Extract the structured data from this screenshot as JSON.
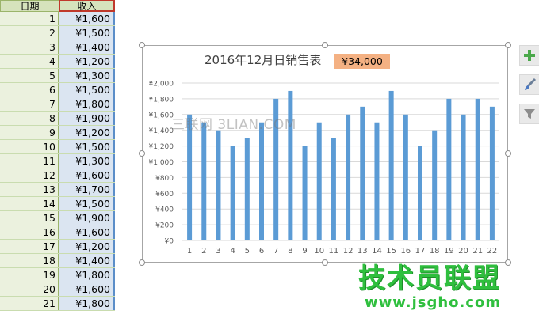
{
  "sheet": {
    "headers": {
      "date": "日期",
      "income": "收入"
    },
    "rows": [
      {
        "day": "1",
        "income": "¥1,600"
      },
      {
        "day": "2",
        "income": "¥1,500"
      },
      {
        "day": "3",
        "income": "¥1,400"
      },
      {
        "day": "4",
        "income": "¥1,200"
      },
      {
        "day": "5",
        "income": "¥1,300"
      },
      {
        "day": "6",
        "income": "¥1,500"
      },
      {
        "day": "7",
        "income": "¥1,800"
      },
      {
        "day": "8",
        "income": "¥1,900"
      },
      {
        "day": "9",
        "income": "¥1,200"
      },
      {
        "day": "10",
        "income": "¥1,500"
      },
      {
        "day": "11",
        "income": "¥1,300"
      },
      {
        "day": "12",
        "income": "¥1,600"
      },
      {
        "day": "13",
        "income": "¥1,700"
      },
      {
        "day": "14",
        "income": "¥1,500"
      },
      {
        "day": "15",
        "income": "¥1,900"
      },
      {
        "day": "16",
        "income": "¥1,600"
      },
      {
        "day": "17",
        "income": "¥1,200"
      },
      {
        "day": "18",
        "income": "¥1,400"
      },
      {
        "day": "19",
        "income": "¥1,800"
      },
      {
        "day": "20",
        "income": "¥1,600"
      },
      {
        "day": "21",
        "income": "¥1,800"
      }
    ]
  },
  "chart": {
    "title": "2016年12月日销售表",
    "total": "¥34,000",
    "watermark": "三联网 3LIAN.COM"
  },
  "chart_data": {
    "type": "bar",
    "title": "2016年12月日销售表",
    "categories": [
      "1",
      "2",
      "3",
      "4",
      "5",
      "6",
      "7",
      "8",
      "9",
      "10",
      "11",
      "12",
      "13",
      "14",
      "15",
      "16",
      "17",
      "18",
      "19",
      "20",
      "21",
      "22"
    ],
    "values": [
      1600,
      1500,
      1400,
      1200,
      1300,
      1500,
      1800,
      1900,
      1200,
      1500,
      1300,
      1600,
      1700,
      1500,
      1900,
      1600,
      1200,
      1400,
      1800,
      1600,
      1800,
      1700
    ],
    "ylim": [
      0,
      2000
    ],
    "yticks": [
      0,
      200,
      400,
      600,
      800,
      1000,
      1200,
      1400,
      1600,
      1800,
      2000
    ],
    "ytick_labels": [
      "¥0",
      "¥200",
      "¥400",
      "¥600",
      "¥800",
      "¥1,000",
      "¥1,200",
      "¥1,400",
      "¥1,600",
      "¥1,800",
      "¥2,000"
    ],
    "bar_color": "#5b9bd5",
    "grid": true
  },
  "tools": [
    {
      "name": "chart-elements-button",
      "icon": "plus-icon"
    },
    {
      "name": "chart-styles-button",
      "icon": "brush-icon"
    },
    {
      "name": "chart-filters-button",
      "icon": "filter-icon"
    }
  ],
  "logo": {
    "text": "技术员联盟",
    "url": "www.jsgho.com"
  }
}
